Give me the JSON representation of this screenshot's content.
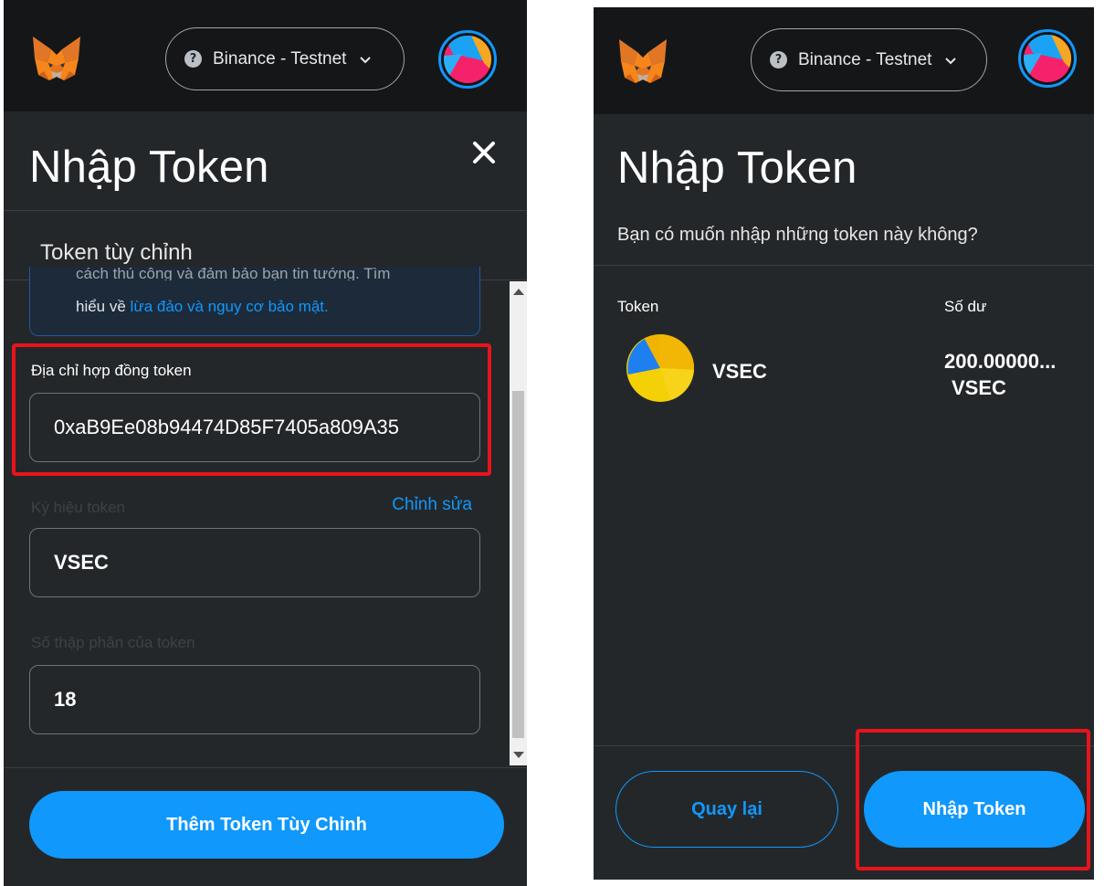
{
  "colors": {
    "accent": "#1098fc",
    "panel_bg": "#24272a",
    "header_bg": "#141618",
    "highlight": "#e8141c"
  },
  "left": {
    "network": "Binance - Testnet",
    "title": "Nhập Token",
    "subtab": "Token tùy chỉnh",
    "notice": {
      "cut_line": "cách thủ công và đảm bảo bạn tin tưởng. Tìm",
      "line2_prefix": "hiểu về ",
      "link": "lừa đảo và nguy cơ bảo mật."
    },
    "fields": {
      "address_label": "Địa chỉ hợp đồng token",
      "address_value": "0xaB9Ee08b94474D85F7405a809A35",
      "symbol_label": "Ký hiệu token",
      "symbol_edit": "Chỉnh sửa",
      "symbol_value": "VSEC",
      "decimals_label": "Số thập phân của token",
      "decimals_value": "18"
    },
    "add_button": "Thêm Token Tùy Chỉnh"
  },
  "right": {
    "network": "Binance - Testnet",
    "title": "Nhập Token",
    "prompt": "Bạn có muốn nhập những token này không?",
    "col_token": "Token",
    "col_balance": "Số dư",
    "token": {
      "name": "VSEC",
      "balance": "200.00000...",
      "unit": "VSEC",
      "icon": "pie-token-icon"
    },
    "back_button": "Quay lại",
    "import_button": "Nhập Token"
  }
}
